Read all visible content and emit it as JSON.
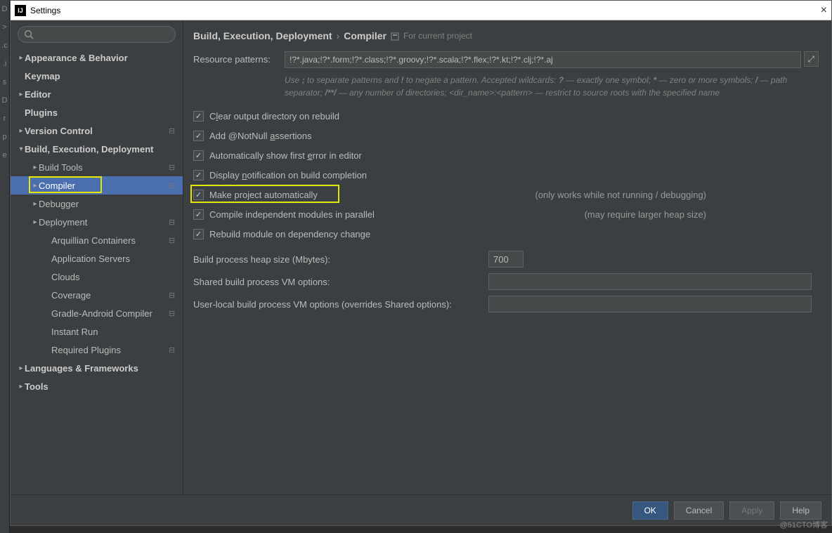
{
  "window": {
    "title": "Settings"
  },
  "breadcrumb": {
    "a": "Build, Execution, Deployment",
    "b": "Compiler",
    "hint": "For current project"
  },
  "sidebar": {
    "items": [
      {
        "label": "Appearance & Behavior",
        "level": 0,
        "arrow": "▸",
        "bold": true
      },
      {
        "label": "Keymap",
        "level": 0,
        "arrow": "",
        "bold": true
      },
      {
        "label": "Editor",
        "level": 0,
        "arrow": "▸",
        "bold": true
      },
      {
        "label": "Plugins",
        "level": 0,
        "arrow": "",
        "bold": true
      },
      {
        "label": "Version Control",
        "level": 0,
        "arrow": "▸",
        "bold": true,
        "mod": true
      },
      {
        "label": "Build, Execution, Deployment",
        "level": 0,
        "arrow": "▾",
        "bold": true
      },
      {
        "label": "Build Tools",
        "level": 1,
        "arrow": "▸",
        "mod": true
      },
      {
        "label": "Compiler",
        "level": 1,
        "arrow": "▸",
        "mod": true,
        "selected": true,
        "hl": true
      },
      {
        "label": "Debugger",
        "level": 1,
        "arrow": "▸"
      },
      {
        "label": "Deployment",
        "level": 1,
        "arrow": "▸",
        "mod": true
      },
      {
        "label": "Arquillian Containers",
        "level": 2,
        "mod": true
      },
      {
        "label": "Application Servers",
        "level": 2
      },
      {
        "label": "Clouds",
        "level": 2
      },
      {
        "label": "Coverage",
        "level": 2,
        "mod": true
      },
      {
        "label": "Gradle-Android Compiler",
        "level": 2,
        "mod": true
      },
      {
        "label": "Instant Run",
        "level": 2
      },
      {
        "label": "Required Plugins",
        "level": 2,
        "mod": true
      },
      {
        "label": "Languages & Frameworks",
        "level": 0,
        "arrow": "▸",
        "bold": true
      },
      {
        "label": "Tools",
        "level": 0,
        "arrow": "▸",
        "bold": true
      }
    ]
  },
  "compiler": {
    "patterns_label": "Resource patterns:",
    "patterns_value": "!?*.java;!?*.form;!?*.class;!?*.groovy;!?*.scala;!?*.flex;!?*.kt;!?*.clj;!?*.aj",
    "help1": "Use ; to separate patterns and ! to negate a pattern. Accepted wildcards: ? — exactly one symbol; * — zero or more symbols; / — path separator; /**/ — any number of directories; <dir_name>:<pattern> — restrict to source roots with the specified name",
    "cb": {
      "clear": "Clear output directory on rebuild",
      "notnull": "Add @NotNull assertions",
      "autoshow": "Automatically show first error in editor",
      "notify": "Display notification on build completion",
      "make": "Make project automatically",
      "make_note": "(only works while not running / debugging)",
      "parallel": "Compile independent modules in parallel",
      "parallel_note": "(may require larger heap size)",
      "rebuild": "Rebuild module on dependency change"
    },
    "heap_label": "Build process heap size (Mbytes):",
    "heap_value": "700",
    "shared_label": "Shared build process VM options:",
    "shared_value": "",
    "user_label": "User-local build process VM options (overrides Shared options):",
    "user_value": ""
  },
  "footer": {
    "ok": "OK",
    "cancel": "Cancel",
    "apply": "Apply",
    "help": "Help"
  },
  "watermark": "@51CTO博客"
}
